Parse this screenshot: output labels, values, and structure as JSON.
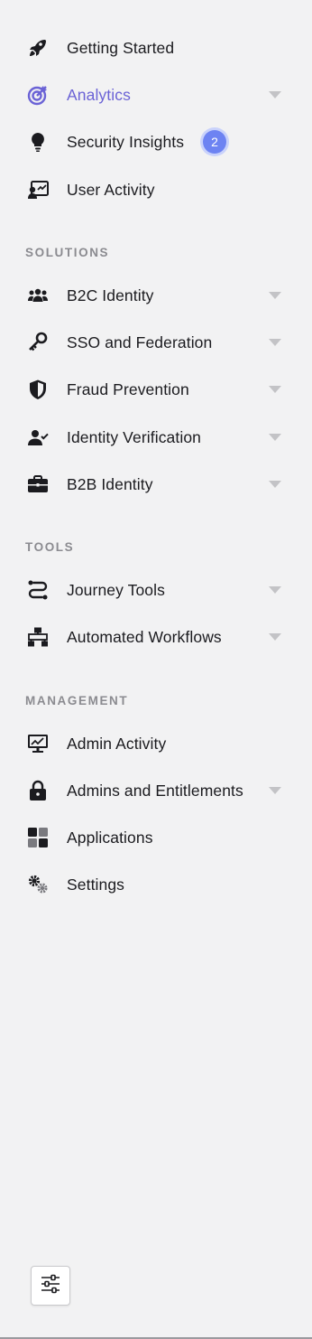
{
  "nav": {
    "top": [
      {
        "label": "Getting Started",
        "icon": "rocket-icon"
      },
      {
        "label": "Analytics",
        "icon": "target-icon",
        "active": true
      },
      {
        "label": "Security Insights",
        "icon": "lightbulb-icon",
        "badge": "2"
      },
      {
        "label": "User Activity",
        "icon": "user-chart-icon"
      }
    ],
    "solutions": {
      "heading": "SOLUTIONS",
      "items": [
        {
          "label": "B2C Identity",
          "icon": "users-icon"
        },
        {
          "label": "SSO and Federation",
          "icon": "key-icon"
        },
        {
          "label": "Fraud Prevention",
          "icon": "shield-icon"
        },
        {
          "label": "Identity Verification",
          "icon": "user-check-icon"
        },
        {
          "label": "B2B Identity",
          "icon": "briefcase-icon"
        }
      ]
    },
    "tools": {
      "heading": "TOOLS",
      "items": [
        {
          "label": "Journey Tools",
          "icon": "route-icon"
        },
        {
          "label": "Automated Workflows",
          "icon": "sitemap-icon"
        }
      ]
    },
    "management": {
      "heading": "MANAGEMENT",
      "items": [
        {
          "label": "Admin Activity",
          "icon": "monitor-chart-icon"
        },
        {
          "label": "Admins and Entitlements",
          "icon": "lock-icon"
        },
        {
          "label": "Applications",
          "icon": "grid-icon"
        },
        {
          "label": "Settings",
          "icon": "gears-icon"
        }
      ]
    }
  },
  "colors": {
    "active": "#6b63d6",
    "badge": "#6d83f2",
    "caret": "#c3c3c6",
    "background": "#f2f2f3"
  },
  "footer": {
    "settings_button_icon": "sliders-icon"
  }
}
